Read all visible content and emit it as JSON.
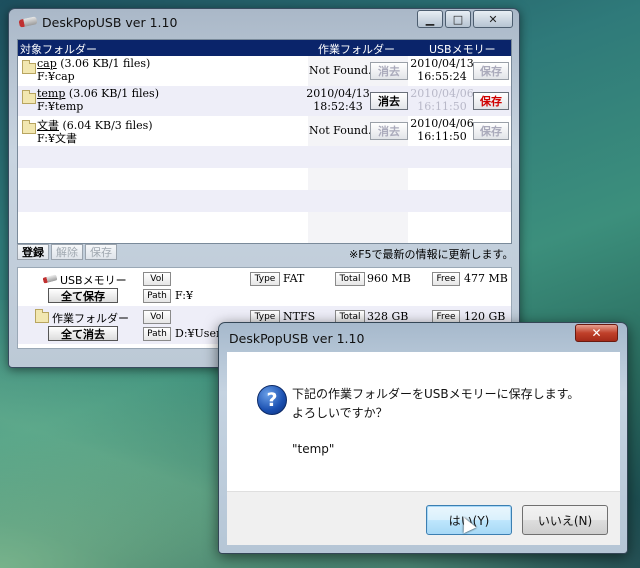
{
  "main_window": {
    "title": "DeskPopUSB ver 1.10",
    "min_glyph": "▁",
    "max_glyph": "□",
    "close_glyph": "✕",
    "columns": {
      "target": "対象フォルダー",
      "work": "作業フォルダー",
      "usb": "USBメモリー"
    },
    "rows": [
      {
        "name": "cap",
        "info": " (3.06 KB/1 files)",
        "path": "F:¥cap",
        "work_status": "Not Found.",
        "clear_label": "消去",
        "usb_date": "2010/04/13",
        "usb_time": "16:55:24",
        "save_label": "保存"
      },
      {
        "name": "temp",
        "info": " (3.06 KB/1 files)",
        "path": "F:¥temp",
        "work_date": "2010/04/13",
        "work_time": "18:52:43",
        "clear_label": "消去",
        "usb_date": "2010/04/06",
        "usb_time": "16:11:50",
        "save_label": "保存"
      },
      {
        "name": "文書",
        "info": " (6.04 KB/3 files)",
        "path": "F:¥文書",
        "work_status": "Not Found.",
        "clear_label": "消去",
        "usb_date": "2010/04/06",
        "usb_time": "16:11:50",
        "save_label": "保存"
      }
    ],
    "actions": {
      "register": "登録",
      "release": "解除",
      "save": "保存"
    },
    "notice": "※F5で最新の情報に更新します。",
    "usb": {
      "label": "USBメモリー",
      "button": "全て保存",
      "vol_tag": "Vol",
      "path_tag": "Path",
      "path": "F:¥",
      "type_tag": "Type",
      "type": "FAT",
      "total_tag": "Total",
      "total": "960 MB",
      "free_tag": "Free",
      "free": "477 MB"
    },
    "work": {
      "label": "作業フォルダー",
      "button": "全て消去",
      "vol_tag": "Vol",
      "path_tag": "Path",
      "path": "D:¥Users¥",
      "type_tag": "Type",
      "type": "NTFS",
      "total_tag": "Total",
      "total": "328 GB",
      "free_tag": "Free",
      "free": "120 GB"
    }
  },
  "dialog": {
    "title": "DeskPopUSB ver 1.10",
    "close_glyph": "✕",
    "icon": "question-icon",
    "icon_glyph": "?",
    "message_line1": "下記の作業フォルダーをUSBメモリーに保存します。",
    "message_line2": "よろしいですか？",
    "folder": "\"temp\"",
    "yes_label": "はい(Y)",
    "no_label": "いいえ(N)"
  }
}
